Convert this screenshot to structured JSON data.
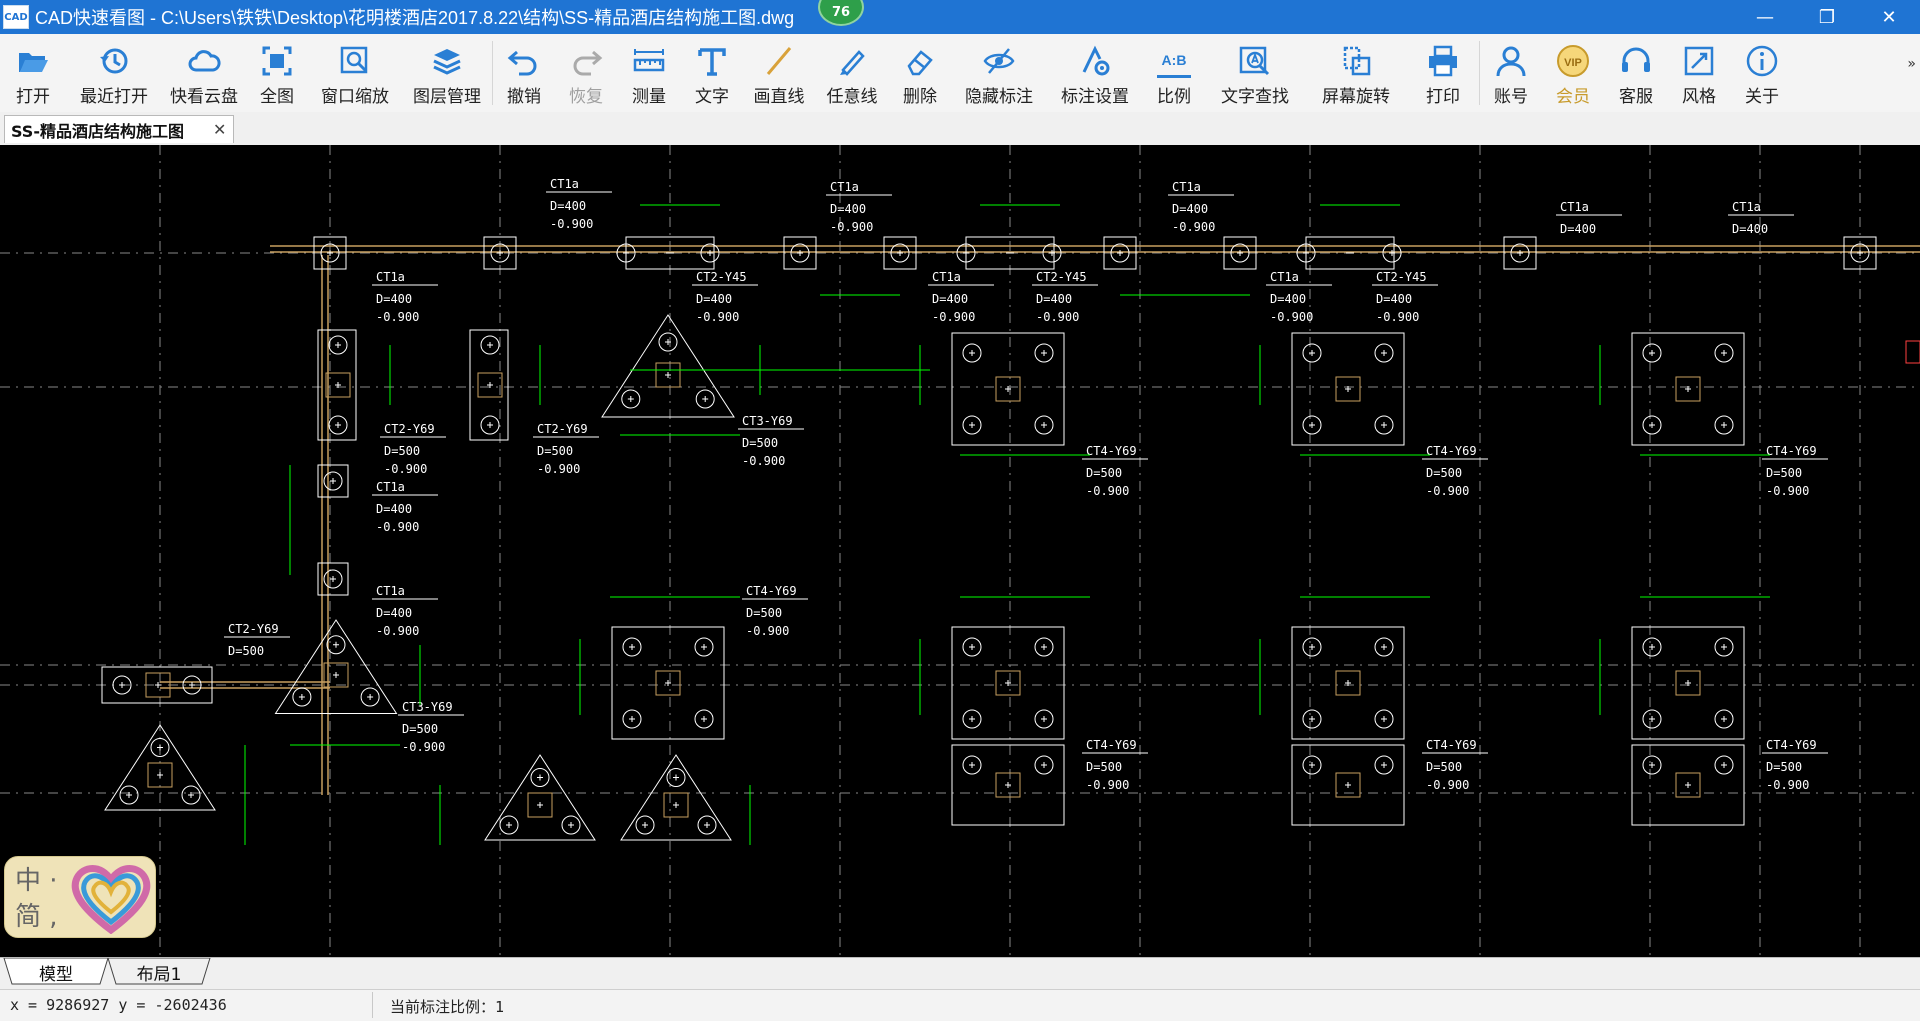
{
  "window": {
    "title": "CAD快速看图 - C:\\Users\\铁铁\\Desktop\\花明楼酒店2017.8.22\\结构\\SS-精品酒店结构施工图.dwg",
    "app_icon_text": "CAD",
    "badge_count": "76",
    "minimize": "—",
    "maximize": "❐",
    "close": "✕"
  },
  "toolbar": {
    "items": [
      {
        "label": "打开",
        "icon": "folder-open-icon"
      },
      {
        "label": "最近打开",
        "icon": "history-icon"
      },
      {
        "label": "快看云盘",
        "icon": "cloud-icon"
      },
      {
        "label": "全图",
        "icon": "fit-all-icon"
      },
      {
        "label": "窗口缩放",
        "icon": "zoom-window-icon"
      },
      {
        "label": "图层管理",
        "icon": "layers-icon"
      },
      {
        "label": "撤销",
        "icon": "undo-icon"
      },
      {
        "label": "恢复",
        "icon": "redo-icon",
        "disabled": true
      },
      {
        "label": "测量",
        "icon": "ruler-icon"
      },
      {
        "label": "文字",
        "icon": "text-icon"
      },
      {
        "label": "画直线",
        "icon": "line-icon"
      },
      {
        "label": "任意线",
        "icon": "pen-icon"
      },
      {
        "label": "删除",
        "icon": "eraser-icon"
      },
      {
        "label": "隐藏标注",
        "icon": "eye-hide-icon"
      },
      {
        "label": "标注设置",
        "icon": "dimension-settings-icon"
      },
      {
        "label": "比例",
        "icon": "ratio-icon",
        "icon_text": "A:B"
      },
      {
        "label": "文字查找",
        "icon": "text-search-icon"
      },
      {
        "label": "屏幕旋转",
        "icon": "rotate-screen-icon"
      },
      {
        "label": "打印",
        "icon": "printer-icon"
      },
      {
        "label": "账号",
        "icon": "user-icon"
      },
      {
        "label": "会员",
        "icon": "vip-icon",
        "icon_text": "VIP",
        "vip": true
      },
      {
        "label": "客服",
        "icon": "headset-icon"
      },
      {
        "label": "风格",
        "icon": "style-icon"
      },
      {
        "label": "关于",
        "icon": "info-icon"
      }
    ],
    "more": "»"
  },
  "doc_tab": {
    "label": "SS-精品酒店结构施工图",
    "close": "✕"
  },
  "language_widget": {
    "text": "中 ·\n简 ,"
  },
  "layout_tabs": [
    {
      "label": "模型",
      "active": true
    },
    {
      "label": "布局1",
      "active": false
    }
  ],
  "status": {
    "coords": "x = 9286927  y = -2602436",
    "scale": "当前标注比例：1"
  },
  "drawing": {
    "colors": {
      "grid": "#ffffff",
      "dim": "#00ff00",
      "beam": "#c8a060",
      "outline": "#ffffff",
      "accent": "#ff4040"
    },
    "labels": {
      "ct1a": "CT1a",
      "ct2": "CT2-Y69",
      "ct2b": "CT2-Y45",
      "ct3": "CT3-Y69",
      "ct4": "CT4-Y69",
      "d400": "D=400",
      "d500": "D=500",
      "elev": "-0.900"
    }
  }
}
